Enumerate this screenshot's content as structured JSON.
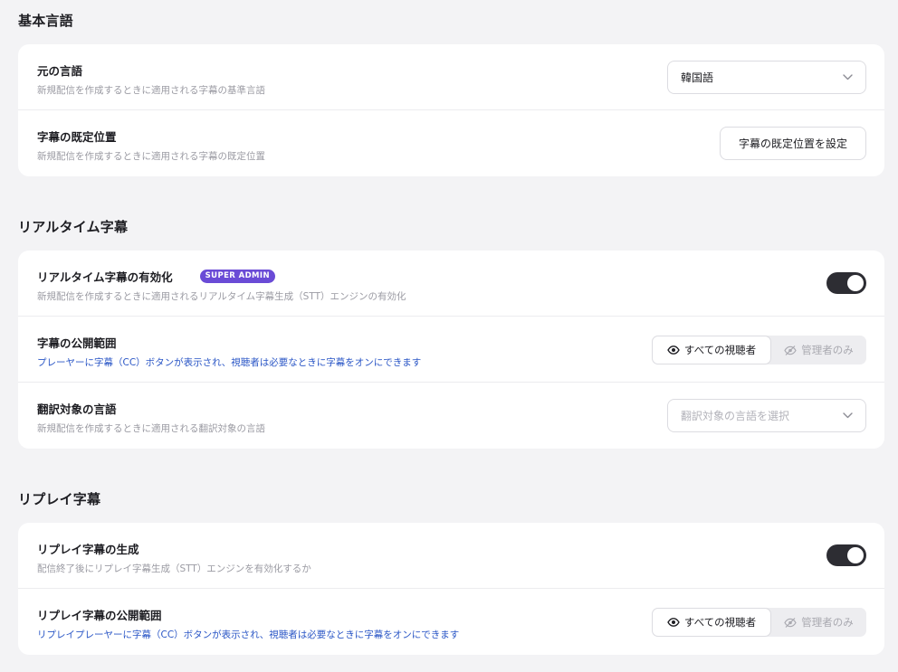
{
  "sections": {
    "basic": {
      "title": "基本言語",
      "rows": {
        "source_language": {
          "title": "元の言語",
          "desc": "新規配信を作成するときに適用される字幕の基準言語",
          "select_value": "韓国語"
        },
        "default_position": {
          "title": "字幕の既定位置",
          "desc": "新規配信を作成するときに適用される字幕の既定位置",
          "button_label": "字幕の既定位置を設定"
        }
      }
    },
    "realtime": {
      "title": "リアルタイム字幕",
      "rows": {
        "enable": {
          "title": "リアルタイム字幕の有効化",
          "badge": "SUPER ADMIN",
          "desc": "新規配信を作成するときに適用されるリアルタイム字幕生成（STT）エンジンの有効化",
          "toggle_on": true
        },
        "visibility": {
          "title": "字幕の公開範囲",
          "desc": "プレーヤーに字幕（CC）ボタンが表示され、視聴者は必要なときに字幕をオンにできます",
          "options": [
            "すべての視聴者",
            "管理者のみ"
          ],
          "selected": "すべての視聴者"
        },
        "target_language": {
          "title": "翻訳対象の言語",
          "desc": "新規配信を作成するときに適用される翻訳対象の言語",
          "select_placeholder": "翻訳対象の言語を選択"
        }
      }
    },
    "replay": {
      "title": "リプレイ字幕",
      "rows": {
        "generate": {
          "title": "リプレイ字幕の生成",
          "desc": "配信終了後にリプレイ字幕生成（STT）エンジンを有効化するか",
          "toggle_on": true
        },
        "visibility": {
          "title": "リプレイ字幕の公開範囲",
          "desc": "リプレイプレーヤーに字幕（CC）ボタンが表示され、視聴者は必要なときに字幕をオンにできます",
          "options": [
            "すべての視聴者",
            "管理者のみ"
          ],
          "selected": "すべての視聴者"
        }
      }
    }
  },
  "colors": {
    "badge": "#6a4bd6",
    "toggle_on": "#2d2d33",
    "link_desc": "#2a56c6"
  },
  "icons": {
    "select_chevron": "chevron-down-icon",
    "visible_option": "eye-icon",
    "hidden_option": "eye-off-icon"
  }
}
